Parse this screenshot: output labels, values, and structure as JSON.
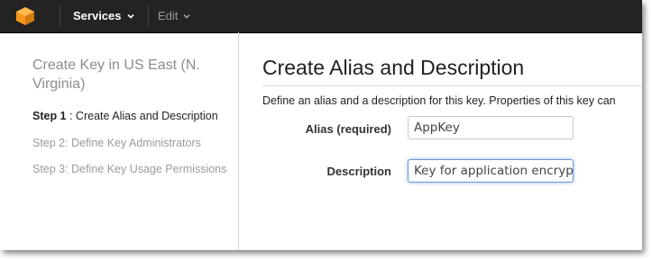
{
  "topbar": {
    "logo_icon": "aws-cube-icon",
    "services_label": "Services",
    "edit_label": "Edit"
  },
  "sidebar": {
    "title": "Create Key in US East (N. Virginia)",
    "steps": [
      {
        "prefix": "Step 1",
        "label": " : Create Alias and Description",
        "active": true
      },
      {
        "label": "Step 2: Define Key Administrators",
        "active": false
      },
      {
        "label": "Step 3: Define Key Usage Permissions",
        "active": false
      }
    ]
  },
  "main": {
    "title": "Create Alias and Description",
    "description": "Define an alias and a description for this key. Properties of this key can",
    "fields": {
      "alias_label": "Alias (required)",
      "alias_value": "AppKey",
      "description_label": "Description",
      "description_value": "Key for application encryp"
    }
  },
  "colors": {
    "topbar_bg": "#232323",
    "logo_orange": "#f7981d",
    "focus_border": "#6a9bd8"
  }
}
